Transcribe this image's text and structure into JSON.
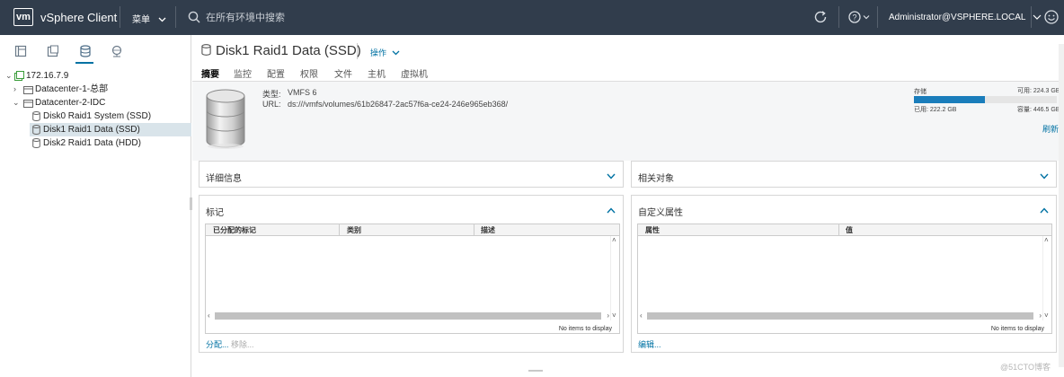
{
  "header": {
    "logo": "vm",
    "app_title": "vSphere Client",
    "menu_label": "菜单",
    "search_placeholder": "在所有环境中搜索",
    "user": "Administrator@VSPHERE.LOCAL"
  },
  "tree": [
    {
      "label": "172.16.7.9",
      "icon": "vcenter-icon"
    },
    {
      "label": "Datacenter-1-总部",
      "icon": "datacenter-icon"
    },
    {
      "label": "Datacenter-2-IDC",
      "icon": "datacenter-icon"
    },
    {
      "label": "Disk0 Raid1 System (SSD)",
      "icon": "datastore-icon"
    },
    {
      "label": "Disk1 Raid1 Data (SSD)",
      "icon": "datastore-icon",
      "selected": true
    },
    {
      "label": "Disk2 Raid1 Data (HDD)",
      "icon": "datastore-icon"
    }
  ],
  "object": {
    "title": "Disk1 Raid1 Data (SSD)",
    "actions_label": "操作"
  },
  "tabs": [
    "摘要",
    "监控",
    "配置",
    "权限",
    "文件",
    "主机",
    "虚拟机"
  ],
  "summary": {
    "type_label": "类型:",
    "type_value": "VMFS 6",
    "url_label": "URL:",
    "url_value": "ds:///vmfs/volumes/61b26847-2ac57f6a-ce24-246e965eb368/",
    "storage_label": "存储",
    "free_label": "可用: 224.3 GB",
    "used_label": "已用: 222.2 GB",
    "capacity_label": "容量: 446.5 GB",
    "used_fraction": 0.4976,
    "refresh_label": "刷新"
  },
  "portlets": {
    "details": {
      "title": "详细信息"
    },
    "related": {
      "title": "相关对象"
    },
    "tags": {
      "title": "标记",
      "columns": [
        "已分配的标记",
        "类别",
        "描述"
      ],
      "empty": "No items to display",
      "assign_label": "分配...",
      "remove_label": "移除..."
    },
    "custom_attrs": {
      "title": "自定义属性",
      "columns": [
        "属性",
        "值"
      ],
      "empty": "No items to display",
      "edit_label": "编辑..."
    }
  },
  "watermark": "@51CTO博客"
}
